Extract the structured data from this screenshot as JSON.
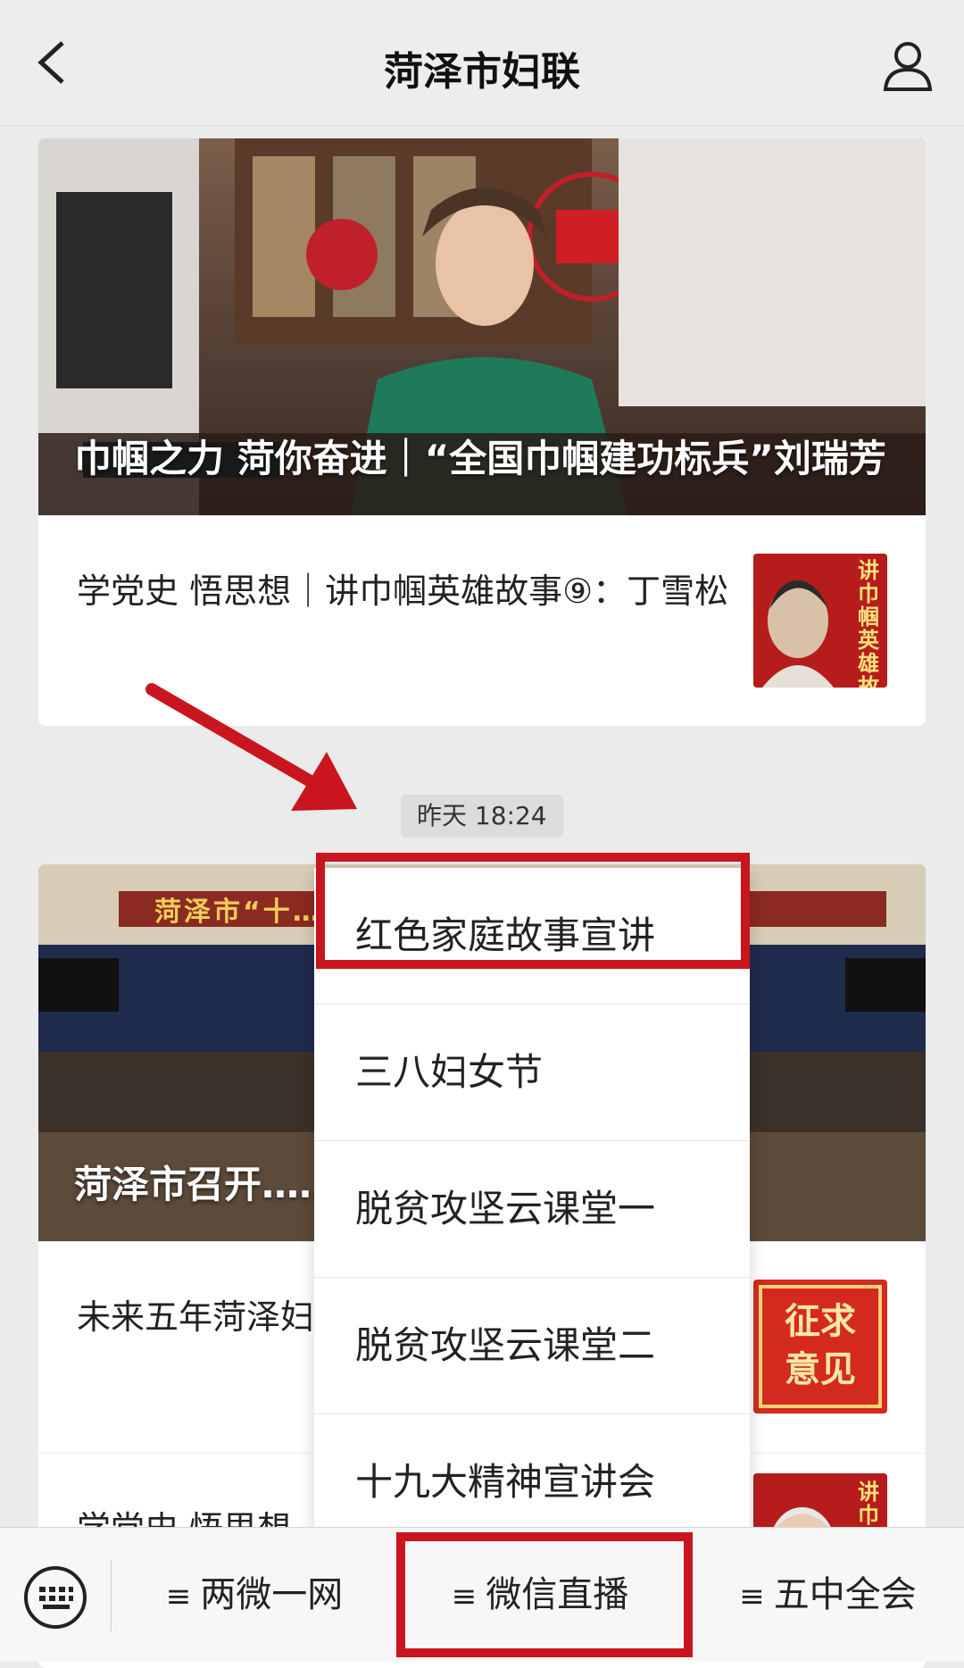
{
  "header": {
    "title": "菏泽市妇联"
  },
  "feed": {
    "card1": {
      "hero_title": "巾帼之力 菏你奋进｜“全国巾帼建功标兵”刘瑞芳",
      "item_title": "学党史 悟思想｜讲巾帼英雄故事⑨：丁雪松",
      "thumb_text": "讲巾帼英雄故事"
    },
    "timestamp": "昨天 18:24",
    "card2": {
      "hero_banner": "菏泽市“十……报会议",
      "hero_title": "菏泽市召开……展规划编制通报会议",
      "items": [
        {
          "title": "未来五年菏泽妇……您的建议很重要",
          "thumb_text": "征求意见"
        },
        {
          "title": "学党史 悟思想……",
          "thumb_text": "讲巾帼"
        }
      ]
    }
  },
  "popup_menu": {
    "items": [
      "红色家庭故事宣讲",
      "三八妇女节",
      "脱贫攻坚云课堂一",
      "脱贫攻坚云课堂二",
      "十九大精神宣讲会"
    ],
    "highlighted_index": 0
  },
  "bottom_menu": {
    "items": [
      "两微一网",
      "微信直播",
      "五中全会"
    ],
    "highlighted_index": 1
  },
  "colors": {
    "annotation_red": "#c9151e",
    "background": "#ebebeb"
  },
  "icons": [
    "back-chevron-icon",
    "profile-icon",
    "keyboard-icon",
    "hamburger-icon"
  ]
}
